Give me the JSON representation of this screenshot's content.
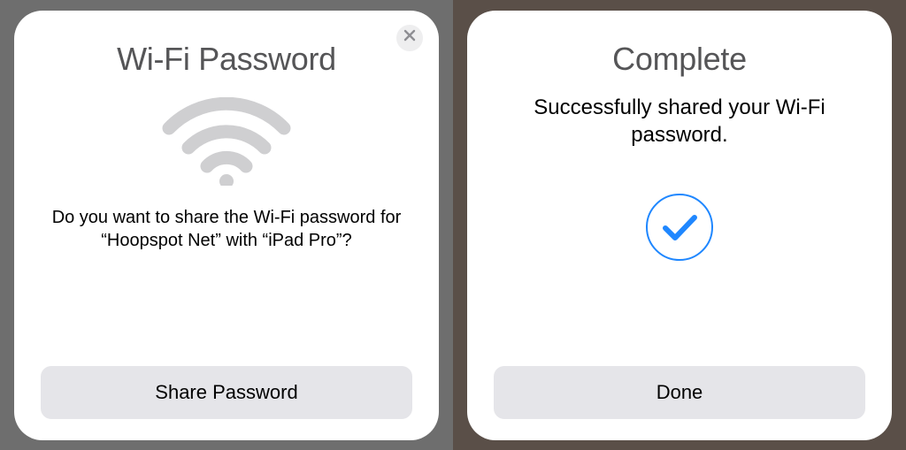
{
  "left_card": {
    "title": "Wi-Fi Password",
    "body": "Do you want to share the Wi-Fi password for “Hoopspot Net” with “iPad Pro”?",
    "button_label": "Share Password"
  },
  "right_card": {
    "title": "Complete",
    "body": "Successfully shared your Wi-Fi password.",
    "button_label": "Done"
  },
  "icons": {
    "close": "close-icon",
    "wifi": "wifi-icon",
    "check": "checkmark-circle-icon"
  },
  "colors": {
    "button_bg": "#e5e5e9",
    "title_gray": "#555557",
    "check_blue": "#1f87ff",
    "wifi_gray": "#cfcfd1"
  }
}
